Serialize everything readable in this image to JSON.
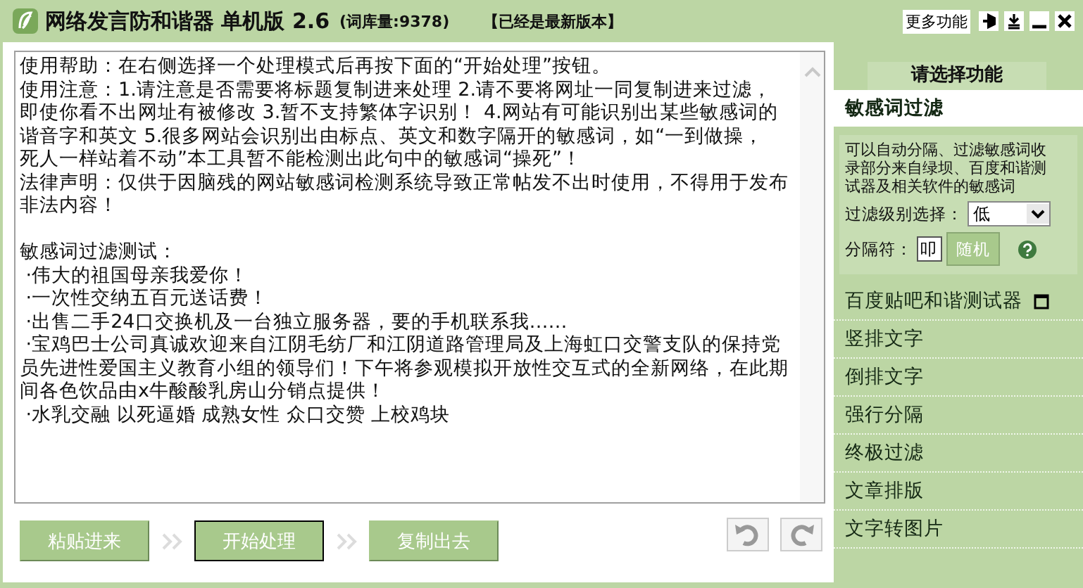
{
  "window": {
    "title": "网络发言防和谐器 单机版 2.6",
    "word_count": "(词库量:9378)",
    "update_status": "【已经是最新版本】",
    "more_button": "更多功能"
  },
  "editor": {
    "notes": [
      "使用帮助：在右侧选择一个处理模式后再按下面的“开始处理”按钮。",
      "使用注意：1.请注意是否需要将标题复制进来处理 2.请不要将网址一同复制进来过滤，",
      "即使你看不出网址有被修改 3.暂不支持繁体字识别！ 4.网站有可能识别出某些敏感词的",
      "谐音字和英文 5.很多网站会识别出由标点、英文和数字隔开的敏感词，如“一到做操，",
      "死人一样站着不动”本工具暂不能检测出此句中的敏感词“操死”！",
      "法律声明：仅供于因脑残的网站敏感词检测系统导致正常帖发不出时使用，不得用于发布",
      "非法内容！"
    ],
    "test_title": "敏感词过滤测试：",
    "test_lines": [
      " ·伟大的祖国母亲我爱你！",
      " ·一次性交纳五百元送话费！",
      " ·出售二手24口交换机及一台独立服务器，要的手机联系我……",
      " ·宝鸡巴士公司真诚欢迎来自江阴毛纺厂和江阴道路管理局及上海虹口交警支队的保持党",
      "员先进性爱国主义教育小组的领导们！下午将参观模拟开放性交互式的全新网络，在此期",
      "间各色饮品由x牛酸酸乳房山分销点提供！",
      " ·水乳交融 以死逼婚 成熟女性 众口交赞 上校鸡块"
    ]
  },
  "actions": [
    {
      "label": "粘贴进来",
      "focused": false
    },
    {
      "label": "开始处理",
      "focused": true
    },
    {
      "label": "复制出去",
      "focused": false
    }
  ],
  "sidebar": {
    "header": "请选择功能",
    "items": [
      {
        "label": "敏感词过滤",
        "selected": true,
        "kind": "panel"
      },
      {
        "label": "百度贴吧和谐测试器",
        "selected": false,
        "kind": "external"
      },
      {
        "label": "竖排文字",
        "selected": false,
        "kind": "plain"
      },
      {
        "label": "倒排文字",
        "selected": false,
        "kind": "plain"
      },
      {
        "label": "强行分隔",
        "selected": false,
        "kind": "plain"
      },
      {
        "label": "终极过滤",
        "selected": false,
        "kind": "plain"
      },
      {
        "label": "文章排版",
        "selected": false,
        "kind": "plain"
      },
      {
        "label": "文字转图片",
        "selected": false,
        "kind": "plain"
      }
    ],
    "panel": {
      "description": "可以自动分隔、过滤敏感词收录部分来自绿坝、百度和谐测试器及相关软件的敏感词",
      "level_label": "过滤级别选择：",
      "level_value": "低",
      "separator_label": "分隔符：",
      "separator_value": "叩",
      "random_button": "随机"
    }
  }
}
